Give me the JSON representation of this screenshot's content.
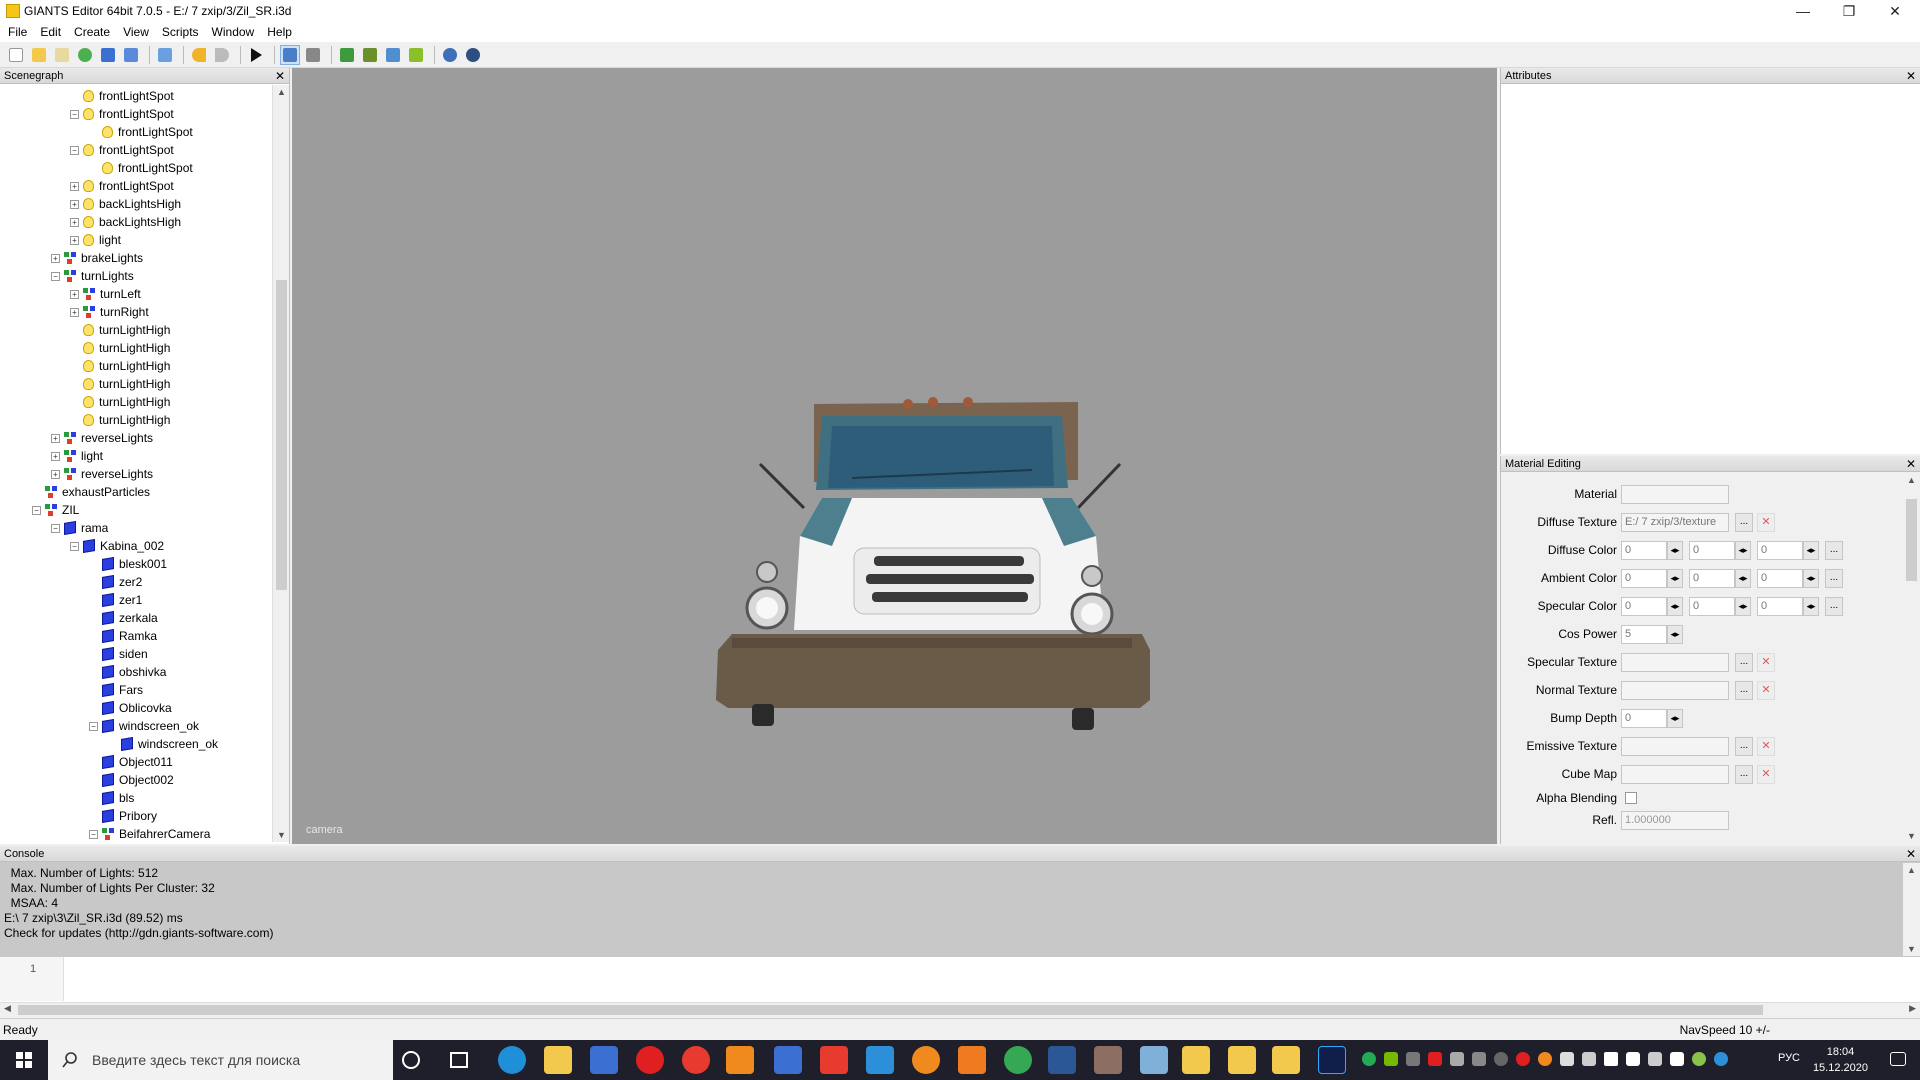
{
  "window": {
    "title": "GIANTS Editor 64bit 7.0.5 - E:/ 7 zxip/3/Zil_SR.i3d",
    "minimize": "—",
    "maximize": "❐",
    "close": "✕"
  },
  "menu": [
    "File",
    "Edit",
    "Create",
    "View",
    "Scripts",
    "Window",
    "Help"
  ],
  "scenegraph": {
    "title": "Scenegraph",
    "nodes": [
      {
        "label": "frontLightSpot",
        "depth": 3,
        "icon": "light",
        "expand": "none"
      },
      {
        "label": "frontLightSpot",
        "depth": 3,
        "icon": "light",
        "expand": "minus"
      },
      {
        "label": "frontLightSpot",
        "depth": 4,
        "icon": "light",
        "expand": "none"
      },
      {
        "label": "frontLightSpot",
        "depth": 3,
        "icon": "light",
        "expand": "minus"
      },
      {
        "label": "frontLightSpot",
        "depth": 4,
        "icon": "light",
        "expand": "none"
      },
      {
        "label": "frontLightSpot",
        "depth": 3,
        "icon": "light",
        "expand": "plus"
      },
      {
        "label": "backLightsHigh",
        "depth": 3,
        "icon": "light",
        "expand": "plus"
      },
      {
        "label": "backLightsHigh",
        "depth": 3,
        "icon": "light",
        "expand": "plus"
      },
      {
        "label": "light",
        "depth": 3,
        "icon": "light",
        "expand": "plus"
      },
      {
        "label": "brakeLights",
        "depth": 2,
        "icon": "group",
        "expand": "plus"
      },
      {
        "label": "turnLights",
        "depth": 2,
        "icon": "group",
        "expand": "minus"
      },
      {
        "label": "turnLeft",
        "depth": 3,
        "icon": "group",
        "expand": "plus"
      },
      {
        "label": "turnRight",
        "depth": 3,
        "icon": "group",
        "expand": "plus"
      },
      {
        "label": "turnLightHigh",
        "depth": 3,
        "icon": "light",
        "expand": "none"
      },
      {
        "label": "turnLightHigh",
        "depth": 3,
        "icon": "light",
        "expand": "none"
      },
      {
        "label": "turnLightHigh",
        "depth": 3,
        "icon": "light",
        "expand": "none"
      },
      {
        "label": "turnLightHigh",
        "depth": 3,
        "icon": "light",
        "expand": "none"
      },
      {
        "label": "turnLightHigh",
        "depth": 3,
        "icon": "light",
        "expand": "none"
      },
      {
        "label": "turnLightHigh",
        "depth": 3,
        "icon": "light",
        "expand": "none"
      },
      {
        "label": "reverseLights",
        "depth": 2,
        "icon": "group",
        "expand": "plus"
      },
      {
        "label": "light",
        "depth": 2,
        "icon": "group",
        "expand": "plus"
      },
      {
        "label": "reverseLights",
        "depth": 2,
        "icon": "group",
        "expand": "plus"
      },
      {
        "label": "exhaustParticles",
        "depth": 1,
        "icon": "group",
        "expand": "none"
      },
      {
        "label": "ZIL",
        "depth": 1,
        "icon": "group",
        "expand": "minus"
      },
      {
        "label": "rama",
        "depth": 2,
        "icon": "mesh",
        "expand": "minus"
      },
      {
        "label": "Kabina_002",
        "depth": 3,
        "icon": "mesh",
        "expand": "minus"
      },
      {
        "label": "blesk001",
        "depth": 4,
        "icon": "mesh",
        "expand": "none"
      },
      {
        "label": "zer2",
        "depth": 4,
        "icon": "mesh",
        "expand": "none"
      },
      {
        "label": "zer1",
        "depth": 4,
        "icon": "mesh",
        "expand": "none"
      },
      {
        "label": "zerkala",
        "depth": 4,
        "icon": "mesh",
        "expand": "none"
      },
      {
        "label": "Ramka",
        "depth": 4,
        "icon": "mesh",
        "expand": "none"
      },
      {
        "label": "siden",
        "depth": 4,
        "icon": "mesh",
        "expand": "none"
      },
      {
        "label": "obshivka",
        "depth": 4,
        "icon": "mesh",
        "expand": "none"
      },
      {
        "label": "Fars",
        "depth": 4,
        "icon": "mesh",
        "expand": "none"
      },
      {
        "label": "Oblicovka",
        "depth": 4,
        "icon": "mesh",
        "expand": "none"
      },
      {
        "label": "windscreen_ok",
        "depth": 4,
        "icon": "mesh",
        "expand": "minus"
      },
      {
        "label": "windscreen_ok",
        "depth": 5,
        "icon": "mesh",
        "expand": "none"
      },
      {
        "label": "Object011",
        "depth": 4,
        "icon": "mesh",
        "expand": "none"
      },
      {
        "label": "Object002",
        "depth": 4,
        "icon": "mesh",
        "expand": "none"
      },
      {
        "label": "bls",
        "depth": 4,
        "icon": "mesh",
        "expand": "none"
      },
      {
        "label": "Pribory",
        "depth": 4,
        "icon": "mesh",
        "expand": "none"
      },
      {
        "label": "BeifahrerCamera",
        "depth": 4,
        "icon": "group",
        "expand": "minus"
      }
    ]
  },
  "viewport": {
    "camera_label": "camera"
  },
  "attributes": {
    "title": "Attributes"
  },
  "material": {
    "title": "Material Editing",
    "material_label": "Material",
    "diffuse_texture_label": "Diffuse Texture",
    "diffuse_texture_value": "E:/ 7 zxip/3/texture",
    "diffuse_color_label": "Diffuse Color",
    "ambient_color_label": "Ambient Color",
    "specular_color_label": "Specular Color",
    "cos_power_label": "Cos Power",
    "cos_power_value": "5",
    "specular_texture_label": "Specular Texture",
    "normal_texture_label": "Normal Texture",
    "bump_depth_label": "Bump Depth",
    "bump_depth_value": "0",
    "emissive_texture_label": "Emissive Texture",
    "cube_map_label": "Cube Map",
    "alpha_blending_label": "Alpha Blending",
    "refl_label": "Refl.",
    "refl_value": "1.000000",
    "zero": "0",
    "dots": "...",
    "spin": "◂▸",
    "redx": "✕"
  },
  "console": {
    "title": "Console",
    "lines": [
      "  Max. Number of Lights: 512",
      "  Max. Number of Lights Per Cluster: 32",
      "  MSAA: 4",
      "E:\\ 7 zxip\\3\\Zil_SR.i3d (89.52) ms",
      "Check for updates (http://gdn.giants-software.com)"
    ],
    "line_number": "1"
  },
  "status": {
    "ready": "Ready",
    "navspeed": "NavSpeed 10 +/-"
  },
  "taskbar": {
    "search_placeholder": "Введите здесь текст для поиска",
    "lang": "РУС",
    "time": "18:04",
    "date": "15.12.2020"
  },
  "colors": {
    "viewport_bg": "#9c9c9c",
    "light_icon": "#ffe26a",
    "mesh_icon": "#2b3fe0",
    "taskbar_bg": "#1f1f2b"
  }
}
